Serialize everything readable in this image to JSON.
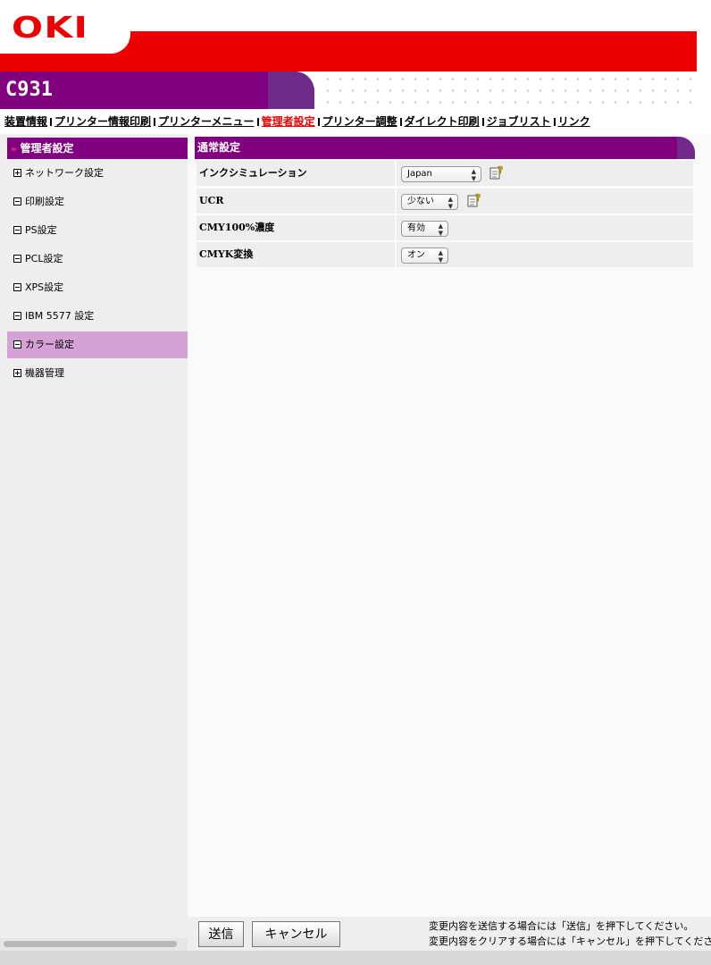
{
  "header": {
    "logo": "OKI",
    "model": "C931"
  },
  "nav": {
    "items": [
      {
        "label": "装置情報"
      },
      {
        "label": "プリンター情報印刷"
      },
      {
        "label": "プリンターメニュー"
      },
      {
        "label": "管理者設定",
        "active": true
      },
      {
        "label": "プリンター調整"
      },
      {
        "label": "ダイレクト印刷"
      },
      {
        "label": "ジョブリスト"
      },
      {
        "label": "リンク"
      }
    ]
  },
  "sidebar": {
    "title": "管理者設定",
    "items": [
      {
        "label": "ネットワーク設定",
        "box": "plus"
      },
      {
        "label": "印刷設定",
        "box": "minus"
      },
      {
        "label": "PS設定",
        "box": "minus"
      },
      {
        "label": "PCL設定",
        "box": "minus"
      },
      {
        "label": "XPS設定",
        "box": "minus"
      },
      {
        "label": "IBM 5577 設定",
        "box": "minus"
      },
      {
        "label": "カラー設定",
        "box": "minus",
        "selected": true
      },
      {
        "label": "機器管理",
        "box": "plus"
      }
    ]
  },
  "main": {
    "section_title": "通常設定",
    "rows": [
      {
        "label": "インクシミュレーション",
        "value": "Japan",
        "help": true
      },
      {
        "label": "UCR",
        "value": "少ない",
        "help": true
      },
      {
        "label": "CMY100%濃度",
        "value": "有効",
        "help": false
      },
      {
        "label": "CMYK変換",
        "value": "オン",
        "help": false
      }
    ]
  },
  "footer": {
    "submit_label": "送信",
    "cancel_label": "キャンセル",
    "note_1": "変更内容を送信する場合には「送信」を押下してください。",
    "note_2": "変更内容をクリアする場合には「キャンセル」を押下してください。"
  },
  "colors": {
    "brand_red": "#ee0000",
    "purple": "#800080",
    "selected": "#d4a2d4"
  }
}
